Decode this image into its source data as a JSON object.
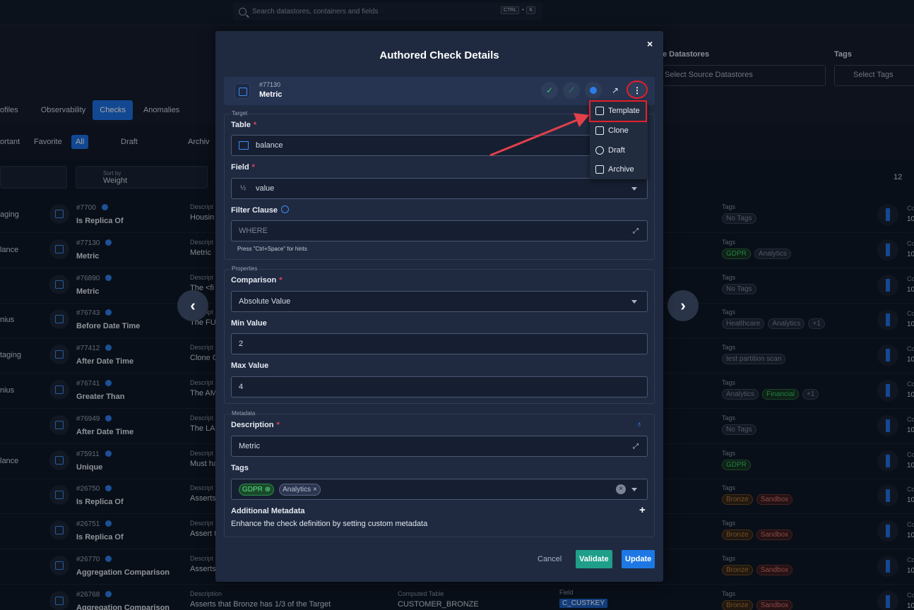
{
  "search": {
    "placeholder": "Search datastores, containers and fields",
    "kbd1": "CTRL",
    "plus": "+",
    "kbd2": "K"
  },
  "background": {
    "tabs": [
      "ofiles",
      "Observability",
      "Checks",
      "Anomalies"
    ],
    "filters": {
      "important": "ortant",
      "favorite": "Favorite",
      "all": "All",
      "draft": "Draft",
      "archived": "Archiv"
    },
    "sort": {
      "label": "Sort by",
      "value": "Weight"
    },
    "source_label": "e Datastores",
    "source_placeholder": "Select Source Datastores",
    "tags_label": "Tags",
    "tags_placeholder": "Select Tags",
    "page_size": "12",
    "rows": [
      {
        "name": "aging",
        "id": "#7700",
        "type": "Is Replica Of",
        "desc_label": "Descript",
        "desc": "Housin",
        "tags_label": "Tags",
        "tags": [
          {
            "t": "No Tags",
            "c": ""
          }
        ],
        "co": "Co",
        "cv": "10"
      },
      {
        "name": "lance",
        "id": "#77130",
        "type": "Metric",
        "desc_label": "Descript",
        "desc": "Metric",
        "tags_label": "Tags",
        "tags": [
          {
            "t": "GDPR",
            "c": "green"
          },
          {
            "t": "Analytics",
            "c": ""
          }
        ],
        "co": "Co",
        "cv": "10"
      },
      {
        "name": "",
        "id": "#76890",
        "type": "Metric",
        "desc_label": "Descript",
        "desc": "The <fi",
        "tags_label": "Tags",
        "tags": [
          {
            "t": "No Tags",
            "c": ""
          }
        ],
        "co": "Co",
        "cv": "10"
      },
      {
        "name": "nius",
        "id": "#76743",
        "type": "Before Date Time",
        "desc_label": "Descript",
        "desc": "The FU",
        "tags_label": "Tags",
        "tags": [
          {
            "t": "Healthcare",
            "c": ""
          },
          {
            "t": "Analytics",
            "c": ""
          },
          {
            "t": "+1",
            "c": ""
          }
        ],
        "co": "Co",
        "cv": "10"
      },
      {
        "name": "taging",
        "id": "#77412",
        "type": "After Date Time",
        "desc_label": "Descript",
        "desc": "Clone O",
        "tags_label": "Tags",
        "tags": [
          {
            "t": "test partition scan",
            "c": ""
          }
        ],
        "co": "Co",
        "cv": "10"
      },
      {
        "name": "nius",
        "id": "#76741",
        "type": "Greater Than",
        "desc_label": "Descript",
        "desc": "The AM",
        "tags_label": "Tags",
        "tags": [
          {
            "t": "Analytics",
            "c": ""
          },
          {
            "t": "Financial",
            "c": "green"
          },
          {
            "t": "+1",
            "c": ""
          }
        ],
        "co": "Co",
        "cv": "10"
      },
      {
        "name": "",
        "id": "#76949",
        "type": "After Date Time",
        "desc_label": "Descript",
        "desc": "The LAS",
        "tags_label": "Tags",
        "tags": [
          {
            "t": "No Tags",
            "c": ""
          }
        ],
        "co": "Co",
        "cv": "10"
      },
      {
        "name": "lance",
        "id": "#75911",
        "type": "Unique",
        "desc_label": "Descript",
        "desc": "Must ha",
        "tags_label": "Tags",
        "tags": [
          {
            "t": "GDPR",
            "c": "green"
          }
        ],
        "co": "Co",
        "cv": "10"
      },
      {
        "name": "",
        "id": "#26750",
        "type": "Is Replica Of",
        "desc_label": "Descript",
        "desc": "Asserts",
        "tags_label": "Tags",
        "tags": [
          {
            "t": "Bronze",
            "c": "brown"
          },
          {
            "t": "Sandbox",
            "c": "red"
          }
        ],
        "co": "Co",
        "cv": "10"
      },
      {
        "name": "",
        "id": "#26751",
        "type": "Is Replica Of",
        "desc_label": "Descript",
        "desc": "Assert t",
        "tags_label": "Tags",
        "tags": [
          {
            "t": "Bronze",
            "c": "brown"
          },
          {
            "t": "Sandbox",
            "c": "red"
          }
        ],
        "co": "Co",
        "cv": "10"
      },
      {
        "name": "",
        "id": "#26770",
        "type": "Aggregation Comparison",
        "desc_label": "Descript",
        "desc": "Asserts",
        "tags_label": "Tags",
        "tags": [
          {
            "t": "Bronze",
            "c": "brown"
          },
          {
            "t": "Sandbox",
            "c": "red"
          }
        ],
        "co": "Co",
        "cv": "10"
      },
      {
        "name": "",
        "id": "#26768",
        "type": "Aggregation Comparison",
        "desc_label": "Description",
        "desc": "Asserts that Bronze has 1/3 of the Target",
        "tags_label": "Tags",
        "tags": [
          {
            "t": "Bronze",
            "c": "brown"
          },
          {
            "t": "Sandbox",
            "c": "red"
          }
        ],
        "co": "Co",
        "cv": "10"
      }
    ],
    "last_row": {
      "computed_label": "Computed Table",
      "computed_value": "CUSTOMER_BRONZE",
      "field_label": "Field",
      "field_value": "C_CUSTKEY"
    }
  },
  "modal": {
    "title": "Authored Check Details",
    "close": "×",
    "check_id": "#77130",
    "check_type": "Metric",
    "target_label": "Target",
    "table_label": "Table",
    "table_value": "balance",
    "field_label": "Field",
    "field_value": "value",
    "filter_label": "Filter Clause",
    "filter_placeholder": "WHERE",
    "filter_hint": "Press \"Ctrl+Space\" for hints",
    "properties_label": "Properties",
    "comparison_label": "Comparison",
    "comparison_value": "Absolute Value",
    "min_label": "Min Value",
    "min_value": "2",
    "max_label": "Max Value",
    "max_value": "4",
    "metadata_label": "Metadata",
    "description_label": "Description",
    "description_value": "Metric",
    "tags_label": "Tags",
    "tags": [
      "GDPR",
      "Analytics"
    ],
    "additional_label": "Additional Metadata",
    "additional_desc": "Enhance the check definition by setting custom metadata",
    "cancel": "Cancel",
    "validate": "Validate",
    "update": "Update"
  },
  "menu": {
    "items": [
      "Template",
      "Clone",
      "Draft",
      "Archive"
    ]
  },
  "colors": {
    "accent": "#1d6fe0",
    "validate": "#1f9e8a",
    "annotation": "#e3202a"
  }
}
